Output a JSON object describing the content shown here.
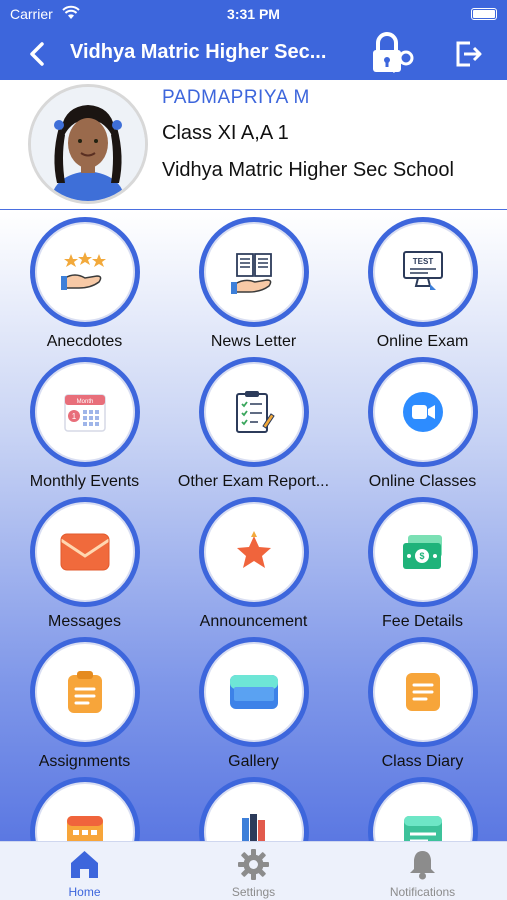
{
  "status_bar": {
    "carrier": "Carrier",
    "time": "3:31 PM"
  },
  "nav": {
    "title": "Vidhya Matric Higher Sec..."
  },
  "profile": {
    "name": "PADMAPRIYA M",
    "class": "Class XI A,A 1",
    "school": "Vidhya Matric Higher Sec School"
  },
  "menu": [
    {
      "label": "Anecdotes"
    },
    {
      "label": "News Letter"
    },
    {
      "label": "Online Exam"
    },
    {
      "label": "Monthly Events"
    },
    {
      "label": "Other Exam Report..."
    },
    {
      "label": "Online Classes"
    },
    {
      "label": "Messages"
    },
    {
      "label": "Announcement"
    },
    {
      "label": "Fee Details"
    },
    {
      "label": "Assignments"
    },
    {
      "label": "Gallery"
    },
    {
      "label": "Class Diary"
    }
  ],
  "tabs": [
    {
      "label": "Home"
    },
    {
      "label": "Settings"
    },
    {
      "label": "Notifications"
    }
  ],
  "colors": {
    "primary": "#3d66dc",
    "tab_inactive": "#8c8c8c"
  }
}
